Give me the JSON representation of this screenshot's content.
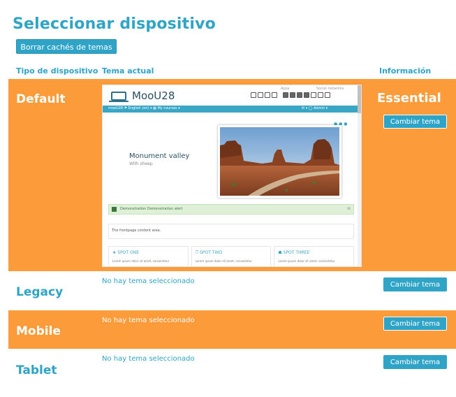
{
  "page": {
    "title": "Seleccionar dispositivo",
    "purge_button": "Borrar cachés de temas"
  },
  "table": {
    "headers": {
      "device_type": "Tipo de dispositivo",
      "current_theme": "Tema actual",
      "info": "Información"
    },
    "rows": [
      {
        "device": "Default",
        "theme": "Essential",
        "button": "Cambiar tema",
        "highlight": true
      },
      {
        "device": "Legacy",
        "status": "No hay tema seleccionado",
        "button": "Cambiar tema",
        "highlight": false
      },
      {
        "device": "Mobile",
        "status": "No hay tema seleccionado",
        "button": "Cambiar tema",
        "highlight": true
      },
      {
        "device": "Tablet",
        "status": "No hay tema seleccionado",
        "button": "Cambiar tema",
        "highlight": false
      }
    ]
  },
  "preview": {
    "site_name": "MooU28",
    "apps_label": "Apps",
    "social_label": "Social networks",
    "nav_left": "mooU28    ⚑ English (en) ▾    ▦ My courses ▾",
    "nav_right": "✉ ▾    ◯ Admin ▾",
    "slide_title": "Monument valley",
    "slide_subtitle": "With sheep",
    "dots": "● ● ●",
    "alert_text": "Demonstration  Demonstration alert",
    "alert_close": "⊗",
    "content_text": "The frontpage content area.",
    "spots": [
      {
        "title": "★  SPOT ONE",
        "body": "Lorem ipsum dolor sit amet, consectetur"
      },
      {
        "title": "⛉  SPOT TWO",
        "body": "Lorem ipsum dolor sit amet, consectetur"
      },
      {
        "title": "☗  SPOT THREE",
        "body": "Lorem ipsum dolor sit amet, consectetur"
      }
    ]
  },
  "colors": {
    "accent": "#2fa4c7",
    "highlight_row": "#fb9b3a",
    "nav_bar": "#3aa6c6"
  }
}
